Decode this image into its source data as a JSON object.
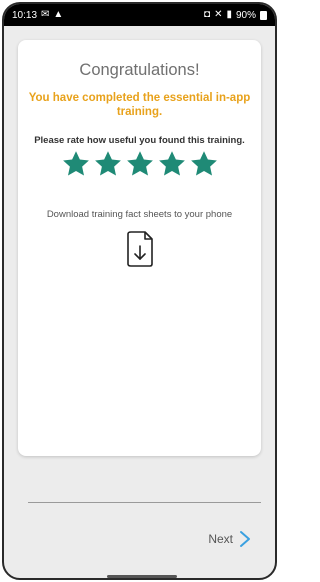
{
  "status_bar": {
    "time": "10:13",
    "battery": "90%",
    "icons": [
      "mail-icon",
      "warning-icon",
      "alarm-icon",
      "mute-icon",
      "signal-icon",
      "battery-icon"
    ]
  },
  "card": {
    "title": "Congratulations!",
    "subtitle": "You have completed the essential in-app training.",
    "rate_prompt": "Please rate how useful you found this training.",
    "rating": {
      "stars_total": 5,
      "stars_filled": 5
    },
    "download_text": "Download training fact sheets to your phone"
  },
  "footer": {
    "next_label": "Next"
  },
  "colors": {
    "accent_title": "#707070",
    "subtitle": "#e8a21c",
    "star": "#1f8a76",
    "chevron": "#3aa0e0"
  }
}
